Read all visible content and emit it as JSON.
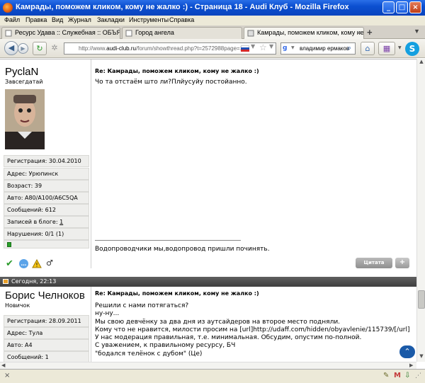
{
  "window": {
    "title": "Камрады, поможем кликом, кому не жалко :) - Страница 18 - Audi Клуб - Mozilla Firefox"
  },
  "menu": [
    "Файл",
    "Правка",
    "Вид",
    "Журнал",
    "Закладки",
    "Инструменты",
    "Справка"
  ],
  "tabs": [
    {
      "label": "Ресурс Удава :: Служебная :: ОБЪЯВЛ..."
    },
    {
      "label": "Город ангела"
    },
    {
      "label": "Камрады, поможем кликом, кому не жа..."
    }
  ],
  "nav": {
    "url_prefix": "http://www.",
    "url_domain": "audi-club.ru",
    "url_rest": "/forum/showthread.php?t=2572988page=18",
    "search_value": "владимир ермаков",
    "search_engine_icon": "google-icon"
  },
  "posts": [
    {
      "username": "РусlaN",
      "user_title": "Завсегдатай",
      "info": [
        {
          "label": "Регистрация: 30.04.2010"
        },
        {
          "label": "Адрес: Урюпинск"
        },
        {
          "label": "Возраст: 39"
        },
        {
          "label": "Авто: A80/A100/A6C5QA"
        },
        {
          "label": "Сообщений: 612"
        },
        {
          "label_prefix": "Записей в блоге: ",
          "label_link": "1"
        },
        {
          "label": "Нарушения: 0/1 (1)"
        }
      ],
      "title": "Re: Камрады, поможем кликом, кому не жалко :)",
      "body": "Чо та отстаём што ли?Плйусуйу постойанно.",
      "signature": "Водопроводчики мы,водопровод пришли починять.",
      "quote_label": "Цитата",
      "plus_label": "+"
    },
    {
      "date": "Сегодня, 22:13",
      "username": "Борис Челноков",
      "user_title": "Новичок",
      "info": [
        {
          "label": "Регистрация: 28.09.2011"
        },
        {
          "label": "Адрес: Тула"
        },
        {
          "label": "Авто: А4"
        },
        {
          "label": "Сообщений: 1"
        }
      ],
      "title": "Re: Камрады, поможем кликом, кому не жалко :)",
      "body": "Решили с нами потягаться?\nну-ну...\nМы свою девчёнку за два дня из аутсайдеров на второе место подняли.\nКому что не нравится, милости просим на [url]http://udaff.com/hidden/obyavlenie/115739/[/url]\nУ нас модерация правильная, т.е. минимальная. Обсудим, опустим по-полной.\nС уважением, к правильному ресурсу, БЧ\n\"бодался телёнок с дубом\" (Це)"
    }
  ],
  "colors": {
    "titlebar": "#0b4fd0",
    "datebar": "#4a4a4a",
    "reputation": "#2aa02a"
  }
}
